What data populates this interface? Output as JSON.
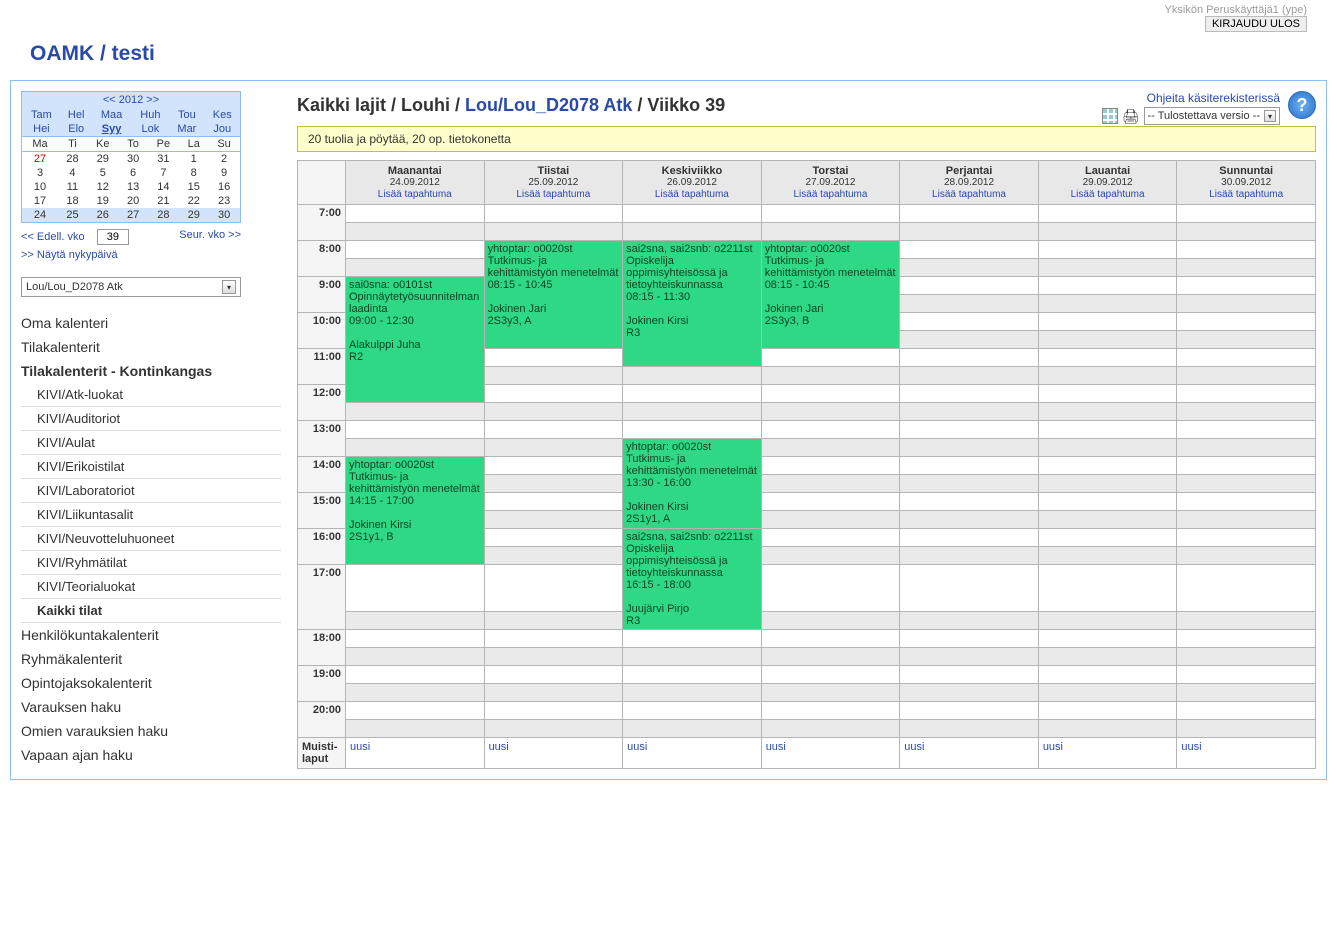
{
  "top": {
    "user_info": "Yksikön Peruskäyttäjä1 (ype)",
    "logout": "KIRJAUDU ULOS",
    "app_title": "OAMK / testi"
  },
  "minical": {
    "prev": "<<",
    "year": "2012",
    "next": ">>",
    "months_row1": [
      "Tam",
      "Hel",
      "Maa",
      "Huh",
      "Tou",
      "Kes"
    ],
    "months_row2": [
      "Hei",
      "Elo",
      "Syy",
      "Lok",
      "Mar",
      "Jou"
    ],
    "selected_month_index": 2,
    "dow": [
      "Ma",
      "Ti",
      "Ke",
      "To",
      "Pe",
      "La",
      "Su"
    ],
    "rows": [
      [
        "27",
        "28",
        "29",
        "30",
        "31",
        "1",
        "2"
      ],
      [
        "3",
        "4",
        "5",
        "6",
        "7",
        "8",
        "9"
      ],
      [
        "10",
        "11",
        "12",
        "13",
        "14",
        "15",
        "16"
      ],
      [
        "17",
        "18",
        "19",
        "20",
        "21",
        "22",
        "23"
      ],
      [
        "24",
        "25",
        "26",
        "27",
        "28",
        "29",
        "30"
      ]
    ],
    "selected_row": 4
  },
  "weeknav": {
    "prev": "<< Edell. vko",
    "week_no": "39",
    "next": "Seur. vko >>",
    "today": ">> Näytä nykypäivä"
  },
  "room_combo": "Lou/Lou_D2078 Atk",
  "sidenav": {
    "items": [
      {
        "label": "Oma kalenteri",
        "lvl": 0
      },
      {
        "label": "Tilakalenterit",
        "lvl": 0
      },
      {
        "label": "Tilakalenterit - Kontinkangas",
        "lvl": 0,
        "bold": true
      },
      {
        "label": "KIVI/Atk-luokat",
        "lvl": 1
      },
      {
        "label": "KIVI/Auditoriot",
        "lvl": 1
      },
      {
        "label": "KIVI/Aulat",
        "lvl": 1
      },
      {
        "label": "KIVI/Erikoistilat",
        "lvl": 1
      },
      {
        "label": "KIVI/Laboratoriot",
        "lvl": 1
      },
      {
        "label": "KIVI/Liikuntasalit",
        "lvl": 1
      },
      {
        "label": "KIVI/Neuvotteluhuoneet",
        "lvl": 1
      },
      {
        "label": "KIVI/Ryhmätilat",
        "lvl": 1
      },
      {
        "label": "KIVI/Teorialuokat",
        "lvl": 1
      },
      {
        "label": "Kaikki tilat",
        "lvl": 1,
        "bold": true
      },
      {
        "label": "Henkilökuntakalenterit",
        "lvl": 0
      },
      {
        "label": "Ryhmäkalenterit",
        "lvl": 0
      },
      {
        "label": "Opintojaksokalenterit",
        "lvl": 0
      },
      {
        "label": "Varauksen haku",
        "lvl": 0
      },
      {
        "label": "Omien varauksien haku",
        "lvl": 0
      },
      {
        "label": "Vapaan ajan haku",
        "lvl": 0
      }
    ]
  },
  "content": {
    "crumb_pre": "Kaikki lajit / Louhi / ",
    "crumb_link": "Lou/Lou_D2078 Atk",
    "crumb_post": " / Viikko 39",
    "help_link": "Ohjeita käsiterekisterissä",
    "print_select": "-- Tulostettava versio --",
    "room_note": "20 tuolia ja pöytää, 20 op. tietokonetta",
    "days": [
      {
        "name": "Maanantai",
        "date": "24.09.2012",
        "add": "Lisää tapahtuma"
      },
      {
        "name": "Tiistai",
        "date": "25.09.2012",
        "add": "Lisää tapahtuma"
      },
      {
        "name": "Keskiviikko",
        "date": "26.09.2012",
        "add": "Lisää tapahtuma"
      },
      {
        "name": "Torstai",
        "date": "27.09.2012",
        "add": "Lisää tapahtuma"
      },
      {
        "name": "Perjantai",
        "date": "28.09.2012",
        "add": "Lisää tapahtuma"
      },
      {
        "name": "Lauantai",
        "date": "29.09.2012",
        "add": "Lisää tapahtuma"
      },
      {
        "name": "Sunnuntai",
        "date": "30.09.2012",
        "add": "Lisää tapahtuma"
      }
    ],
    "hours": [
      "7:00",
      "8:00",
      "9:00",
      "10:00",
      "11:00",
      "12:00",
      "13:00",
      "14:00",
      "15:00",
      "16:00",
      "17:00",
      "18:00",
      "19:00",
      "20:00"
    ],
    "memo_label": "Muisti-laput",
    "memo_link": "uusi",
    "events": {
      "mon_9": "sai0sna: o0101st Opinnäytetyösuunnitelman laadinta\n09:00 - 12:30\n\nAlakulppi Juha\nR2",
      "mon_14": "yhtoptar: o0020st Tutkimus- ja kehittämistyön menetelmät\n14:15 - 17:00\n\nJokinen Kirsi\n2S1y1, B",
      "tue_8": "yhtoptar: o0020st Tutkimus- ja kehittämistyön menetelmät\n08:15 - 10:45\n\nJokinen Jari\n2S3y3, A",
      "wed_8": "sai2sna, sai2snb: o2211st Opiskelija oppimisyhteisössä ja tietoyhteiskunnassa\n08:15 - 11:30\n\nJokinen Kirsi\nR3",
      "wed_1330": "yhtoptar: o0020st Tutkimus- ja kehittämistyön menetelmät\n13:30 - 16:00\n\nJokinen Kirsi\n2S1y1, A",
      "wed_1615": "sai2sna, sai2snb: o2211st Opiskelija oppimisyhteisössä ja tietoyhteiskunnassa\n16:15 - 18:00\n\nJuujärvi Pirjo\nR3",
      "thu_8": "yhtoptar: o0020st Tutkimus- ja kehittämistyön menetelmät\n08:15 - 10:45\n\nJokinen Jari\n2S3y3, B"
    }
  }
}
